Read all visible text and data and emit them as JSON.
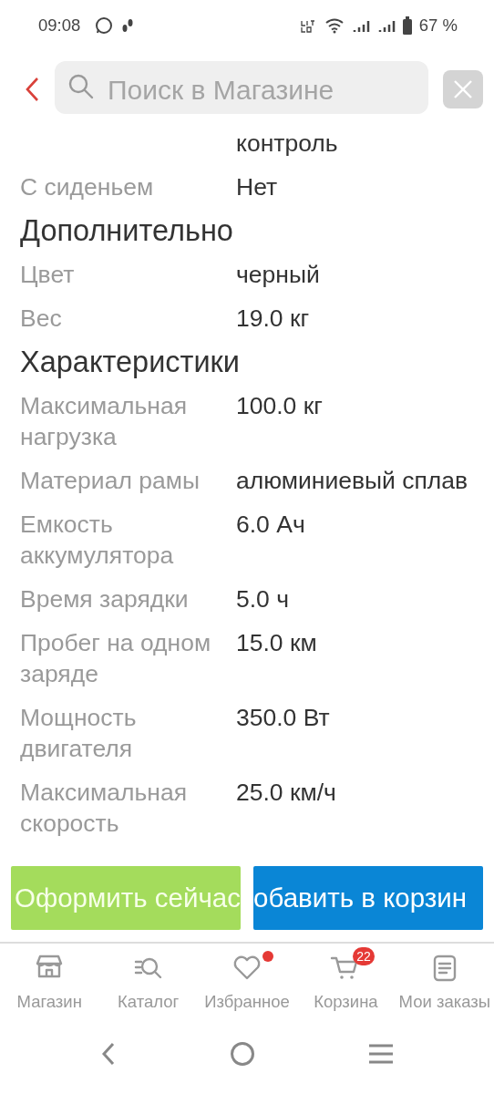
{
  "status_bar": {
    "time": "09:08",
    "battery": "67 %"
  },
  "search": {
    "placeholder": "Поиск в Магазине"
  },
  "specs": [
    {
      "kind": "row",
      "value": "контроль"
    },
    {
      "kind": "row",
      "label": "С сиденьем",
      "value": "Нет"
    },
    {
      "kind": "heading",
      "label": "Дополнительно"
    },
    {
      "kind": "row",
      "label": "Цвет",
      "value": "черный"
    },
    {
      "kind": "row",
      "label": "Вес",
      "value": "19.0 кг"
    },
    {
      "kind": "heading",
      "label": "Характеристики"
    },
    {
      "kind": "row",
      "label": "Максимальная нагрузка",
      "value": "100.0 кг"
    },
    {
      "kind": "row",
      "label": "Материал рамы",
      "value": "алюминиевый сплав"
    },
    {
      "kind": "row",
      "label": "Емкость аккумулятора",
      "value": "6.0 Ач"
    },
    {
      "kind": "row",
      "label": "Время зарядки",
      "value": "5.0 ч"
    },
    {
      "kind": "row",
      "label": "Пробег на одном заряде",
      "value": "15.0 км"
    },
    {
      "kind": "row",
      "label": "Мощность двигателя",
      "value": "350.0 Вт"
    },
    {
      "kind": "row",
      "label": "Максимальная скорость",
      "value": "25.0 км/ч"
    }
  ],
  "actions": [
    {
      "kind": "checkout",
      "label": "Оформить сейчас"
    },
    {
      "kind": "cart",
      "label": "обавить в корзин"
    }
  ],
  "tabs": [
    {
      "kind": "shop",
      "label": "Магазин",
      "selected": false
    },
    {
      "kind": "catalog",
      "label": "Каталог",
      "selected": false
    },
    {
      "kind": "favorites",
      "label": "Избранное",
      "selected": false,
      "dot": true
    },
    {
      "kind": "cart",
      "label": "Корзина",
      "selected": false,
      "badge": "22"
    },
    {
      "kind": "orders",
      "label": "Мои заказы",
      "selected": false
    }
  ]
}
